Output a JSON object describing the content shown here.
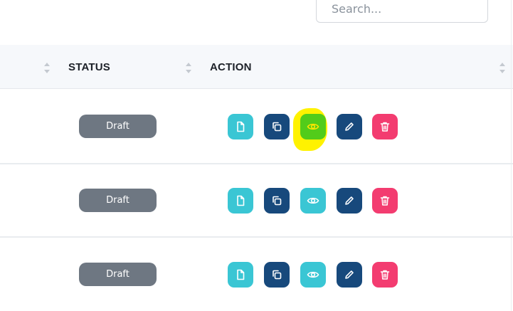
{
  "search": {
    "placeholder": "Search..."
  },
  "table": {
    "columns": [
      {
        "label": "STATUS"
      },
      {
        "label": "ACTION"
      }
    ],
    "rows": [
      {
        "status": "Draft",
        "highlighted_action": "view"
      },
      {
        "status": "Draft"
      },
      {
        "status": "Draft"
      }
    ],
    "action_buttons": [
      "document-icon",
      "copy-icon",
      "eye-icon",
      "pencil-icon",
      "trash-icon"
    ]
  },
  "colors": {
    "teal": "#3ac6d4",
    "navy": "#17497c",
    "red": "#f33c70",
    "status_gray": "#6e7782",
    "highlight_yellow": "#fff200",
    "highlighted_green": "#52cc1a"
  }
}
